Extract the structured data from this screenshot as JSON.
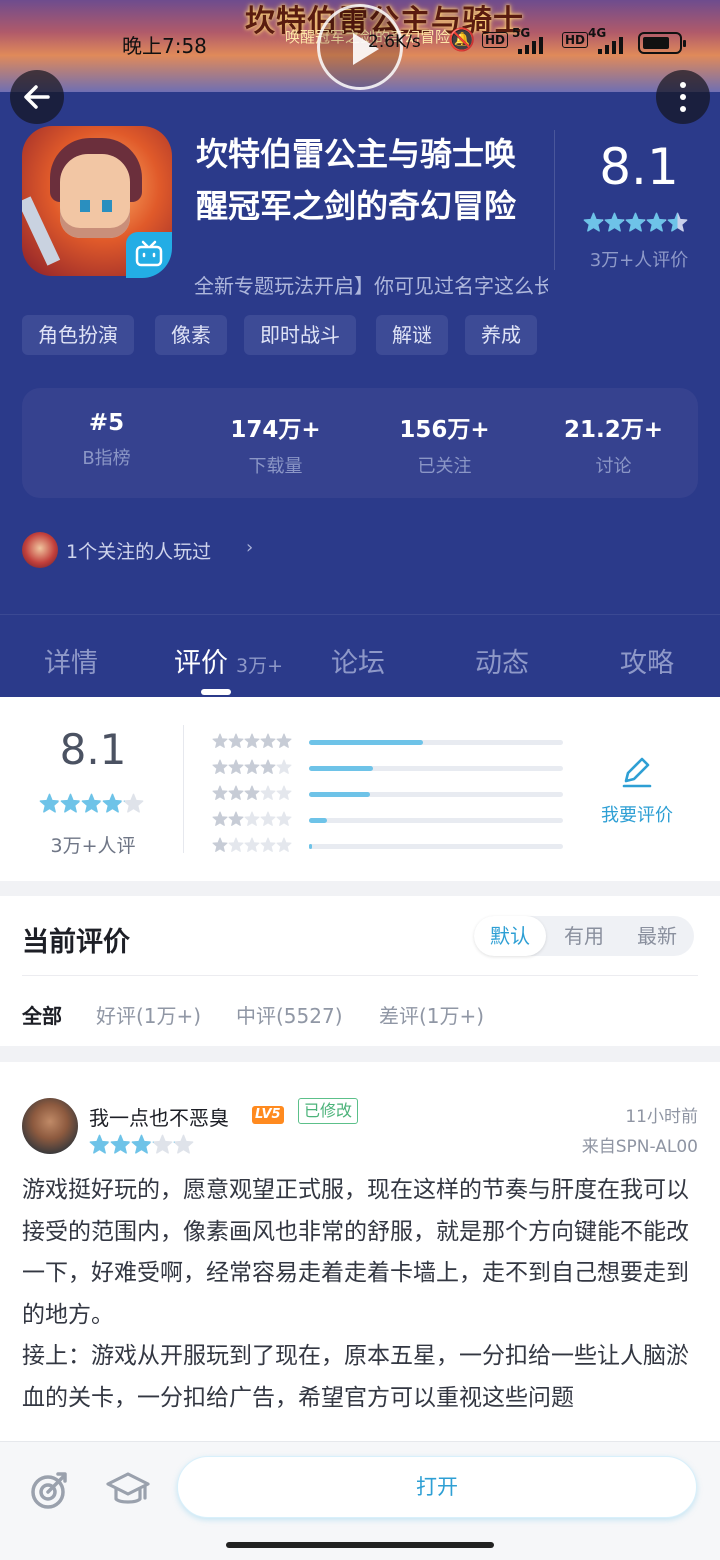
{
  "status_bar": {
    "time": "晚上7:58",
    "network_speed": "2.6K/s",
    "hd1": "HD",
    "net1": "5G",
    "hd2": "HD",
    "net2": "4G"
  },
  "banner": {
    "title": "坎特伯雷公主与骑士",
    "subtitle": "唤醒冠军之剑的奇幻冒险"
  },
  "app": {
    "title": "坎特伯雷公主与骑士唤醒冠军之剑的奇幻冒险",
    "description": "全新专题玩法开启】你可见过名字这么长的游戏",
    "score": "8.1",
    "rating_count": "3万+人评价",
    "stars": 4.5,
    "tags": [
      "角色扮演",
      "像素",
      "即时战斗",
      "解谜",
      "养成"
    ]
  },
  "stats": [
    {
      "value": "#5",
      "label": "B指榜"
    },
    {
      "value": "174万+",
      "label": "下载量"
    },
    {
      "value": "156万+",
      "label": "已关注"
    },
    {
      "value": "21.2万+",
      "label": "讨论"
    }
  ],
  "friends": {
    "text": "1个关注的人玩过"
  },
  "tabs": [
    {
      "label": "详情"
    },
    {
      "label": "评价",
      "sub": "3万+",
      "active": true
    },
    {
      "label": "论坛"
    },
    {
      "label": "动态"
    },
    {
      "label": "攻略"
    }
  ],
  "rating_summary": {
    "score": "8.1",
    "count": "3万+人评",
    "stars": 4,
    "distribution": [
      {
        "stars": 5,
        "fraction": 0.45
      },
      {
        "stars": 4,
        "fraction": 0.25
      },
      {
        "stars": 3,
        "fraction": 0.24
      },
      {
        "stars": 2,
        "fraction": 0.07
      },
      {
        "stars": 1,
        "fraction": 0.01
      }
    ],
    "write_label": "我要评价"
  },
  "reviews_section": {
    "title": "当前评价",
    "sort_options": [
      "默认",
      "有用",
      "最新"
    ],
    "active_sort": 0,
    "filters": [
      "全部",
      "好评(1万+)",
      "中评(5527)",
      "差评(1万+)"
    ],
    "active_filter": 0
  },
  "review": {
    "username": "我一点也不恶臭",
    "level": "LV5",
    "edited_label": "已修改",
    "stars": 3,
    "time": "11小时前",
    "device": "来自SPN-AL00",
    "paragraphs": [
      "游戏挺好玩的，愿意观望正式服，现在这样的节奏与肝度在我可以接受的范围内，像素画风也非常的舒服，就是那个方向键能不能改一下，好难受啊，经常容易走着走着卡墙上，走不到自己想要走到的地方。",
      "接上：游戏从开服玩到了现在，原本五星，一分扣给一些让人脑淤血的关卡，一分扣给广告，希望官方可以重视这些问题"
    ]
  },
  "bottom_bar": {
    "open_label": "打开"
  },
  "colors": {
    "hero_bg": "#2b3a8a",
    "accent": "#2e9fd4",
    "star_filled": "#6ec3e8",
    "star_empty": "#dfe3ea"
  }
}
